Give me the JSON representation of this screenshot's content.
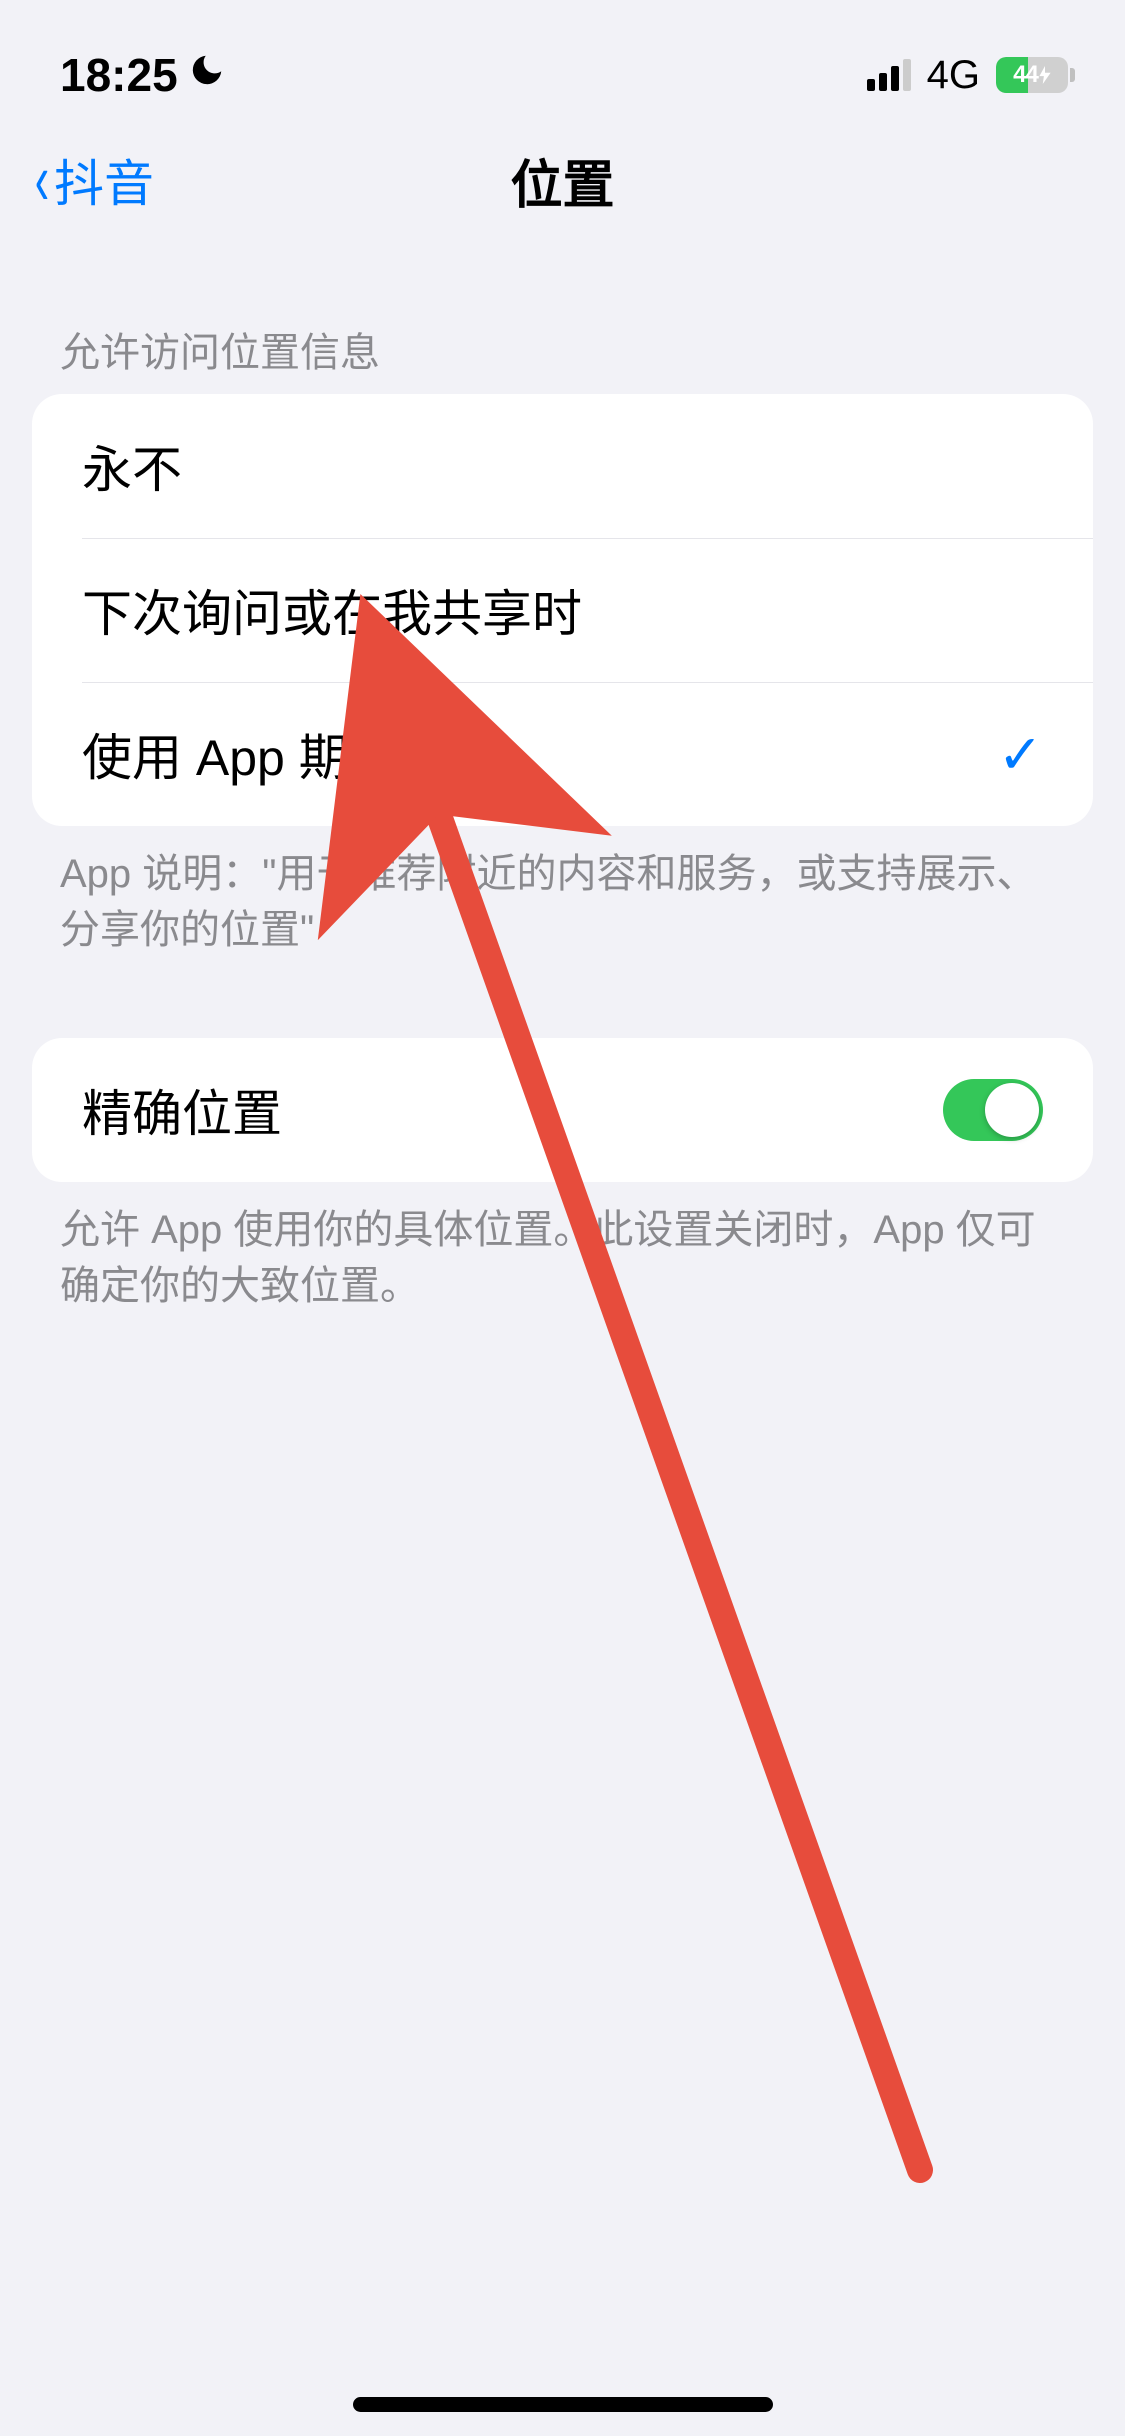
{
  "statusBar": {
    "time": "18:25",
    "network": "4G",
    "batteryText": "44"
  },
  "nav": {
    "backLabel": "抖音",
    "title": "位置"
  },
  "section1": {
    "header": "允许访问位置信息",
    "options": [
      {
        "label": "永不"
      },
      {
        "label": "下次询问或在我共享时"
      },
      {
        "label": "使用 App 期间"
      }
    ],
    "footer": "App 说明：\"用于推荐附近的内容和服务，或支持展示、分享你的位置\""
  },
  "section2": {
    "preciseLabel": "精确位置",
    "footer": "允许 App 使用你的具体位置。此设置关闭时，App 仅可确定你的大致位置。"
  }
}
